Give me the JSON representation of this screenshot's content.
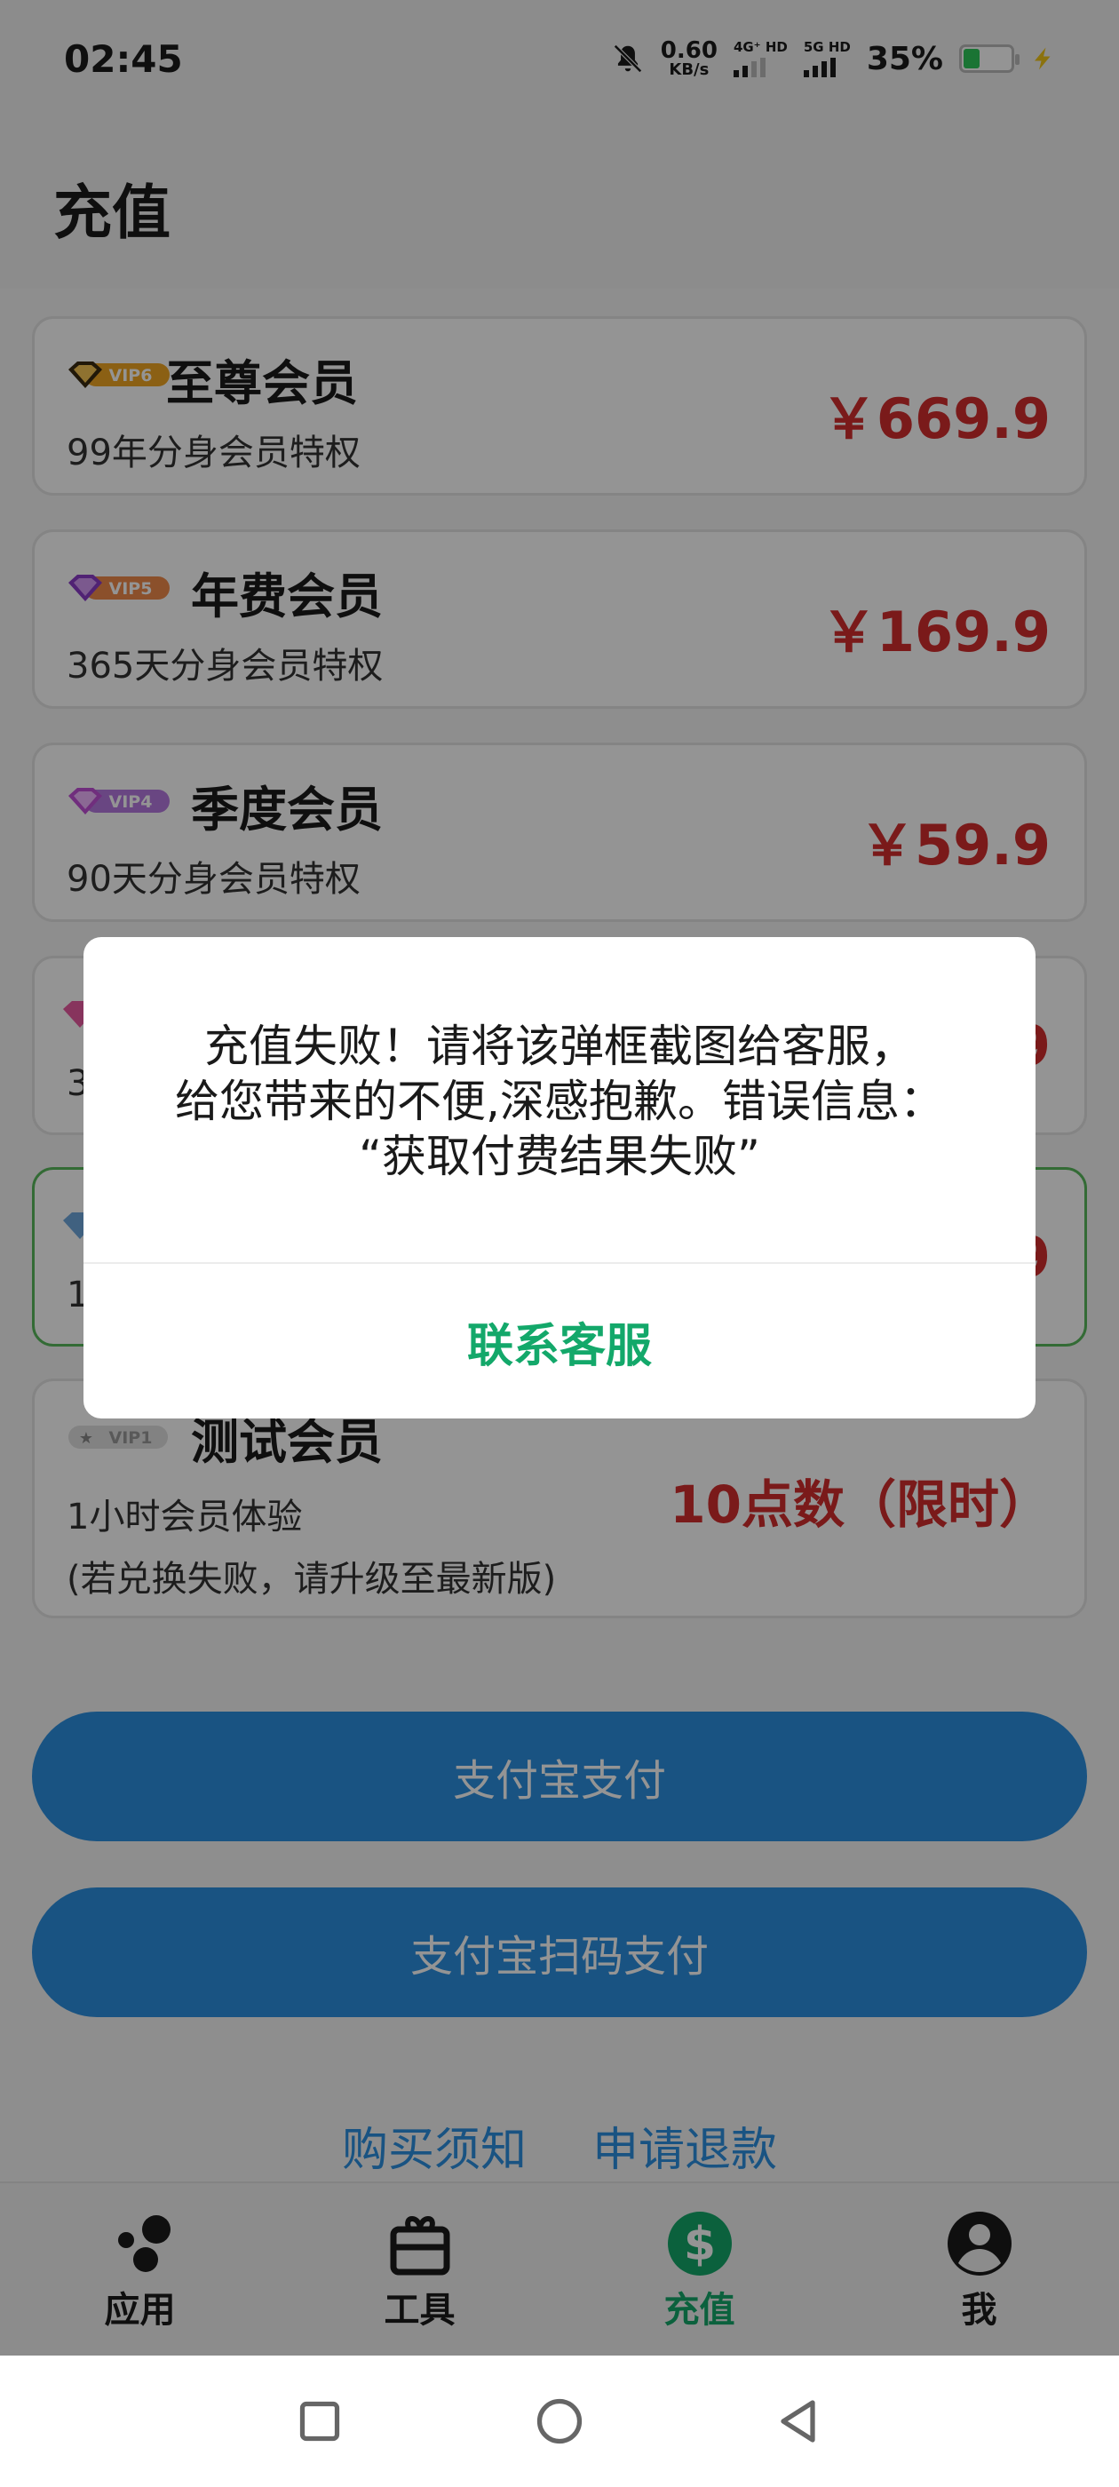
{
  "status_bar": {
    "time": "02:45",
    "speed_value": "0.60",
    "speed_unit": "KB/s",
    "sim1_label": "4G⁺ HD",
    "sim2_label": "5G HD",
    "battery_percent": "35%",
    "battery_level": 0.35
  },
  "header": {
    "title": "充值"
  },
  "plans": [
    {
      "badge": "VIP6",
      "name": "至尊会员",
      "desc": "99年分身会员特权",
      "price": "￥669.9",
      "badge_color": "#f0a623"
    },
    {
      "badge": "VIP5",
      "name": "年费会员",
      "desc": "365天分身会员特权",
      "price": "￥169.9",
      "badge_color": "#f08a4b"
    },
    {
      "badge": "VIP4",
      "name": "季度会员",
      "desc": "90天分身会员特权",
      "price": "￥59.9",
      "badge_color": "#b679e0"
    },
    {
      "badge": "",
      "name": "",
      "desc": "3",
      "price": "9",
      "badge_color": "#e85aa0"
    },
    {
      "badge": "",
      "name": "",
      "desc": "1",
      "price": "9",
      "badge_color": "#6fa8dc"
    },
    {
      "badge": "VIP1",
      "name": "测试会员",
      "desc": "1小时会员体验",
      "desc2": "(若兑换失败，请升级至最新版)",
      "price": "10点数（限时）",
      "badge_color": "#c9c9c9"
    }
  ],
  "buttons": {
    "alipay": "支付宝支付",
    "alipay_qr": "支付宝扫码支付"
  },
  "links": {
    "notice": "购买须知",
    "refund": "申请退款"
  },
  "nav": [
    {
      "label": "应用",
      "icon": "apps-icon"
    },
    {
      "label": "工具",
      "icon": "toolbox-icon"
    },
    {
      "label": "充值",
      "icon": "dollar-icon"
    },
    {
      "label": "我",
      "icon": "profile-icon"
    }
  ],
  "dialog": {
    "line1": "充值失败！请将该弹框截图给客服，",
    "line2": "给您带来的不便,深感抱歉。错误信息：",
    "line3": "“获取付费结果失败”",
    "button": "联系客服"
  },
  "colors": {
    "price": "#d22e2e",
    "accent_green": "#13a86a",
    "button_blue": "#2b8fe0",
    "selected_border": "#58b85c"
  }
}
